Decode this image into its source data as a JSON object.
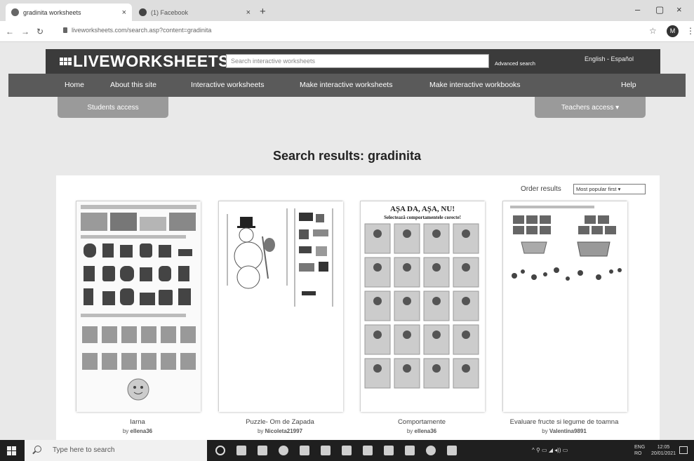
{
  "browser": {
    "tabs": [
      {
        "label": "gradinita worksheets",
        "active": true
      },
      {
        "label": "(1) Facebook",
        "active": false
      }
    ],
    "new_tab": "+",
    "url": "liveworksheets.com/search.asp?content=gradinita",
    "profile_initial": "M",
    "window": {
      "minimize": "–",
      "maximize": "▢",
      "close": "×"
    }
  },
  "site": {
    "logo": "LIVEWORKSHEETS",
    "search_placeholder": "Search interactive worksheets",
    "advanced_search": "Advanced search",
    "language": "English - Español",
    "nav": [
      "Home",
      "About this site",
      "Interactive worksheets",
      "Make interactive worksheets",
      "Make interactive workbooks",
      "Help"
    ],
    "students_access": "Students access",
    "teachers_access": "Teachers access ▾"
  },
  "results": {
    "title": "Search results: gradinita",
    "order_label": "Order results",
    "order_value": "Most popular first",
    "items": [
      {
        "title": "Iarna",
        "by": "by",
        "author": "ellena36"
      },
      {
        "title": "Puzzle- Om de Zapada",
        "by": "by",
        "author": "Nicoleta21997"
      },
      {
        "title": "Comportamente",
        "by": "by",
        "author": "ellena36",
        "thumb_heading": "AȘA DA, AȘA, NU!",
        "thumb_sub": "Selectează comportamentele corecte!"
      },
      {
        "title": "Evaluare fructe si legume de toamna",
        "by": "by",
        "author": "Valentina9891"
      }
    ]
  },
  "taskbar": {
    "search_placeholder": "Type here to search",
    "lang": "ENG",
    "lang_sub": "RO",
    "time": "12:05",
    "date": "20/01/2021"
  }
}
